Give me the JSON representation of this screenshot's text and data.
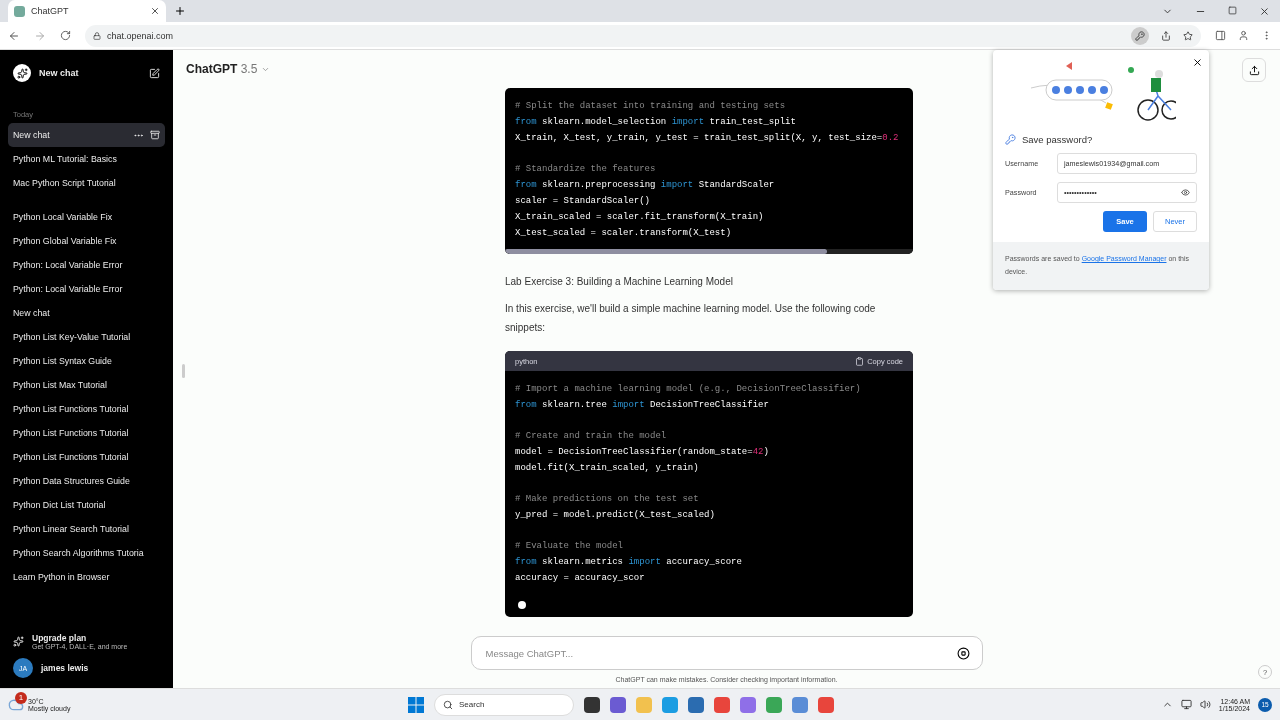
{
  "browser": {
    "tab": {
      "title": "ChatGPT",
      "selected": true
    },
    "url": "chat.openai.com"
  },
  "sidebar": {
    "new_chat": "New chat",
    "sections": [
      {
        "label": "Today",
        "items": [
          {
            "title": "New chat",
            "selected": true
          },
          {
            "title": "Python ML Tutorial: Basics",
            "selected": false
          },
          {
            "title": "Mac Python Script Tutorial",
            "selected": false
          }
        ]
      },
      {
        "items": [
          {
            "title": "Python Local Variable Fix",
            "selected": false
          },
          {
            "title": "Python Global Variable Fix",
            "selected": false
          },
          {
            "title": "Python: Local Variable Error",
            "selected": false
          },
          {
            "title": "Python: Local Variable Error",
            "selected": false
          },
          {
            "title": "New chat",
            "selected": false
          },
          {
            "title": "Python List Key-Value Tutorial",
            "selected": false
          },
          {
            "title": "Python List Syntax Guide",
            "selected": false
          },
          {
            "title": "Python List Max Tutorial",
            "selected": false
          },
          {
            "title": "Python List Functions Tutorial",
            "selected": false
          },
          {
            "title": "Python List Functions Tutorial",
            "selected": false
          },
          {
            "title": "Python List Functions Tutorial",
            "selected": false
          },
          {
            "title": "Python Data Structures Guide",
            "selected": false
          },
          {
            "title": "Python Dict List Tutorial",
            "selected": false
          },
          {
            "title": "Python Linear Search Tutorial",
            "selected": false
          },
          {
            "title": "Python Search Algorithms Tutoria",
            "selected": false
          },
          {
            "title": "Learn Python in Browser",
            "selected": false
          }
        ]
      }
    ],
    "upgrade": {
      "title": "Upgrade plan",
      "subtitle": "Get GPT-4, DALL·E, and more"
    },
    "user": {
      "initials": "JA",
      "name": "james lewis"
    }
  },
  "header": {
    "model": "ChatGPT",
    "version": "3.5"
  },
  "content": [
    {
      "kind": "code",
      "groups": [
        [
          [
            {
              "kind": "comment",
              "text": "# Split the dataset into training and testing sets"
            }
          ],
          [
            {
              "kind": "keyword",
              "text": "from"
            },
            {
              "kind": "plain",
              "text": " sklearn.model_selection "
            },
            {
              "kind": "keyword",
              "text": "import"
            },
            {
              "kind": "plain",
              "text": " train_test_split"
            }
          ],
          [
            {
              "kind": "plain",
              "text": "X_train, X_test, y_train, y_test = train_test_split(X, y, test_size="
            },
            {
              "kind": "number",
              "text": "0.2"
            }
          ]
        ],
        [
          [
            {
              "kind": "comment",
              "text": "# Standardize the features"
            }
          ],
          [
            {
              "kind": "keyword",
              "text": "from"
            },
            {
              "kind": "plain",
              "text": " sklearn.preprocessing "
            },
            {
              "kind": "keyword",
              "text": "import"
            },
            {
              "kind": "plain",
              "text": " StandardScaler"
            }
          ],
          [
            {
              "kind": "plain",
              "text": "scaler = StandardScaler()"
            }
          ],
          [
            {
              "kind": "plain",
              "text": "X_train_scaled = scaler.fit_transform(X_train)"
            }
          ],
          [
            {
              "kind": "plain",
              "text": "X_test_scaled = scaler.transform(X_test)"
            }
          ]
        ]
      ]
    },
    {
      "kind": "heading",
      "text": "Lab Exercise 3: Building a Machine Learning Model"
    },
    {
      "kind": "paragraph",
      "text": "In this exercise, we'll build a simple machine learning model. Use the following code snippets:"
    },
    {
      "kind": "code",
      "language": "python",
      "copy": "Copy code",
      "streaming": true,
      "groups": [
        [
          [
            {
              "kind": "comment",
              "text": "# Import a machine learning model (e.g., DecisionTreeClassifier)"
            }
          ],
          [
            {
              "kind": "keyword",
              "text": "from"
            },
            {
              "kind": "plain",
              "text": " sklearn.tree "
            },
            {
              "kind": "keyword",
              "text": "import"
            },
            {
              "kind": "plain",
              "text": " DecisionTreeClassifier"
            }
          ]
        ],
        [
          [
            {
              "kind": "comment",
              "text": "# Create and train the model"
            }
          ],
          [
            {
              "kind": "plain",
              "text": "model = DecisionTreeClassifier(random_state="
            },
            {
              "kind": "number",
              "text": "42"
            },
            {
              "kind": "plain",
              "text": ")"
            }
          ],
          [
            {
              "kind": "plain",
              "text": "model.fit(X_train_scaled, y_train)"
            }
          ]
        ],
        [
          [
            {
              "kind": "comment",
              "text": "# Make predictions on the test set"
            }
          ],
          [
            {
              "kind": "plain",
              "text": "y_pred = model.predict(X_test_scaled)"
            }
          ]
        ],
        [
          [
            {
              "kind": "comment",
              "text": "# Evaluate the model"
            }
          ],
          [
            {
              "kind": "keyword",
              "text": "from"
            },
            {
              "kind": "plain",
              "text": " sklearn.metrics "
            },
            {
              "kind": "keyword",
              "text": "import"
            },
            {
              "kind": "plain",
              "text": " accuracy_score"
            }
          ],
          [
            {
              "kind": "plain",
              "text": "accuracy = accuracy_scor"
            }
          ]
        ]
      ]
    }
  ],
  "composer": {
    "placeholder": "Message ChatGPT...",
    "disclaimer": "ChatGPT can make mistakes. Consider checking important information.",
    "help": "?"
  },
  "password_popup": {
    "title": "Save password?",
    "username_label": "Username",
    "username": "jameslewis01934@gmail.com",
    "password_label": "Password",
    "password": "•••••••••••••",
    "save": "Save",
    "never": "Never",
    "footer_before": "Passwords are saved to ",
    "footer_link": "Google Password Manager",
    "footer_after": " on this device."
  },
  "taskbar": {
    "weather": {
      "temp": "30°C",
      "condition": "Mostly cloudy",
      "badge": "1"
    },
    "search": "Search",
    "time": "12:46 AM",
    "date": "1/15/2024",
    "notifications": "15"
  }
}
